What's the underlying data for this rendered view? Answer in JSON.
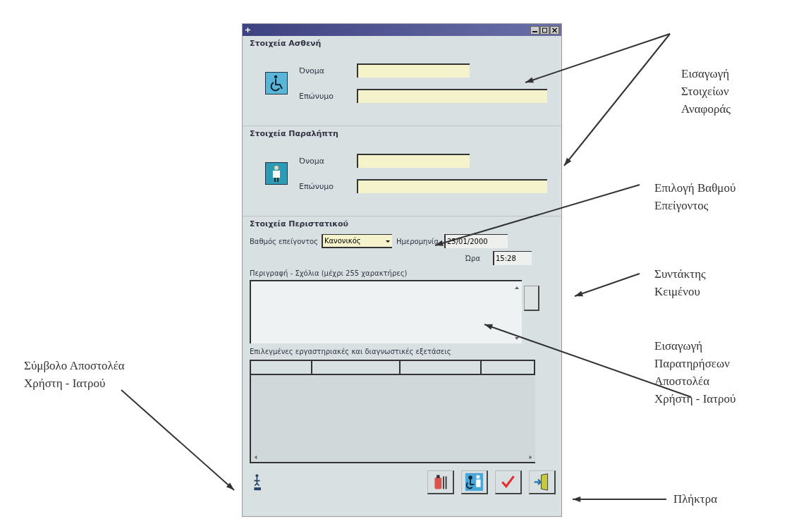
{
  "window": {
    "sections": [
      {
        "title": "Στοιχεία Ασθενή",
        "kind": "patient",
        "fields": [
          {
            "label": "Όνομα"
          },
          {
            "label": "Επώνυμο"
          }
        ]
      },
      {
        "title": "Στοιχεία Παραλήπτη",
        "kind": "recipient",
        "fields": [
          {
            "label": "Όνομα"
          },
          {
            "label": "Επώνυμο"
          }
        ]
      }
    ],
    "incident": {
      "title": "Στοιχεία Περιστατικού",
      "urgency": {
        "label": "Βαθμός επείγοντος",
        "value": "Κανονικός"
      },
      "date": {
        "label": "Ημερομηνία",
        "value": "25/01/2000"
      },
      "time": {
        "label": "Ώρα",
        "value": "15:28"
      },
      "description_label": "Περιγραφή - Σχόλια (μέχρι 255 χαρακτήρες)",
      "tests_label": "Επιλεγμένες εργαστηριακές και διαγνωστικές εξετάσεις"
    },
    "buttons": [
      {
        "kind": "bottle"
      },
      {
        "kind": "patient-doctor"
      },
      {
        "kind": "check"
      },
      {
        "kind": "exit"
      }
    ]
  },
  "annotations": [
    {
      "text": "Εισαγωγή\nΣτοιχείων\nΑναφοράς"
    },
    {
      "text": "Επιλογή   Βαθμού\nΕπείγοντος"
    },
    {
      "text": "Συντάκτης\nΚειμένου"
    },
    {
      "text": "Σύμβολο Αποστολέα\nΧρήστη - Ιατρού"
    },
    {
      "text": "Εισαγωγή\nΠαρατηρήσεων\nΑποστολέα\nΧρήστη - Ιατρού"
    },
    {
      "text": "Πλήκτρα"
    }
  ]
}
